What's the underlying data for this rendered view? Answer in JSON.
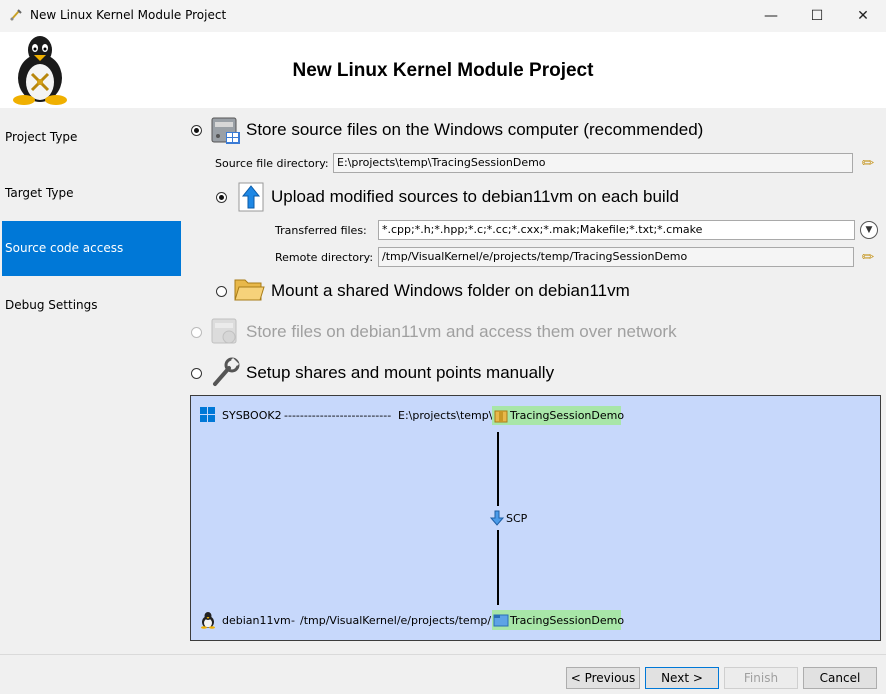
{
  "window": {
    "title": "New Linux Kernel Module Project",
    "minimize": "—",
    "maximize": "☐",
    "close": "✕"
  },
  "header": {
    "title": "New Linux Kernel Module Project"
  },
  "sidebar": {
    "items": [
      {
        "label": "Project Type"
      },
      {
        "label": "Target Type"
      },
      {
        "label": "Source code access"
      },
      {
        "label": "Debug Settings"
      }
    ]
  },
  "options": {
    "store_windows": {
      "label": "Store source files on the Windows computer (recommended)",
      "selected": true
    },
    "source_dir": {
      "label": "Source file directory:",
      "value": "E:\\projects\\temp\\TracingSessionDemo"
    },
    "upload": {
      "label": "Upload modified sources to debian11vm on each build",
      "selected": true
    },
    "transferred": {
      "label": "Transferred files:",
      "value": "*.cpp;*.h;*.hpp;*.c;*.cc;*.cxx;*.mak;Makefile;*.txt;*.cmake"
    },
    "remote_dir": {
      "label": "Remote directory:",
      "value": "/tmp/VisualKernel/e/projects/temp/TracingSessionDemo"
    },
    "mount": {
      "label": "Mount a shared Windows folder on debian11vm",
      "selected": false
    },
    "store_remote": {
      "label": "Store files on debian11vm and access them over network",
      "enabled": false
    },
    "manual": {
      "label": "Setup shares and mount points manually",
      "selected": false
    }
  },
  "diagram": {
    "host": "SYSBOOK2",
    "host_dashes": "---------------------------",
    "host_path": "E:\\projects\\temp\\",
    "host_folder": "TracingSessionDemo",
    "transfer": "SCP",
    "remote": "debian11vm",
    "remote_sep": "-",
    "remote_path": "/tmp/VisualKernel/e/projects/temp/",
    "remote_folder": "TracingSessionDemo"
  },
  "footer": {
    "previous": "< Previous",
    "next": "Next >",
    "finish": "Finish",
    "cancel": "Cancel"
  },
  "colors": {
    "accent": "#0078d7",
    "diagram_bg": "#c7d8fb",
    "highlight": "#a8e6a8"
  }
}
